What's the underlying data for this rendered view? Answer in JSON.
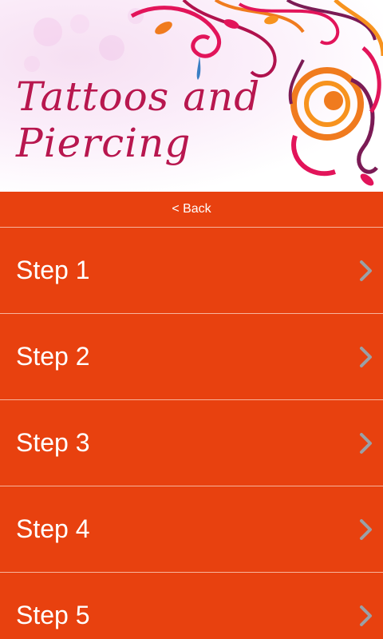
{
  "header": {
    "title_line1": "Tattoos and",
    "title_line2": "Piercing"
  },
  "nav": {
    "back_label": "< Back"
  },
  "steps": [
    {
      "label": "Step 1"
    },
    {
      "label": "Step 2"
    },
    {
      "label": "Step 3"
    },
    {
      "label": "Step 4"
    },
    {
      "label": "Step 5"
    }
  ],
  "icons": {
    "chevron": "chevron-right-icon"
  },
  "colors": {
    "accent": "#e8410f",
    "title": "#b8174f",
    "chevron": "#9aa0a6",
    "text": "#ffffff"
  }
}
